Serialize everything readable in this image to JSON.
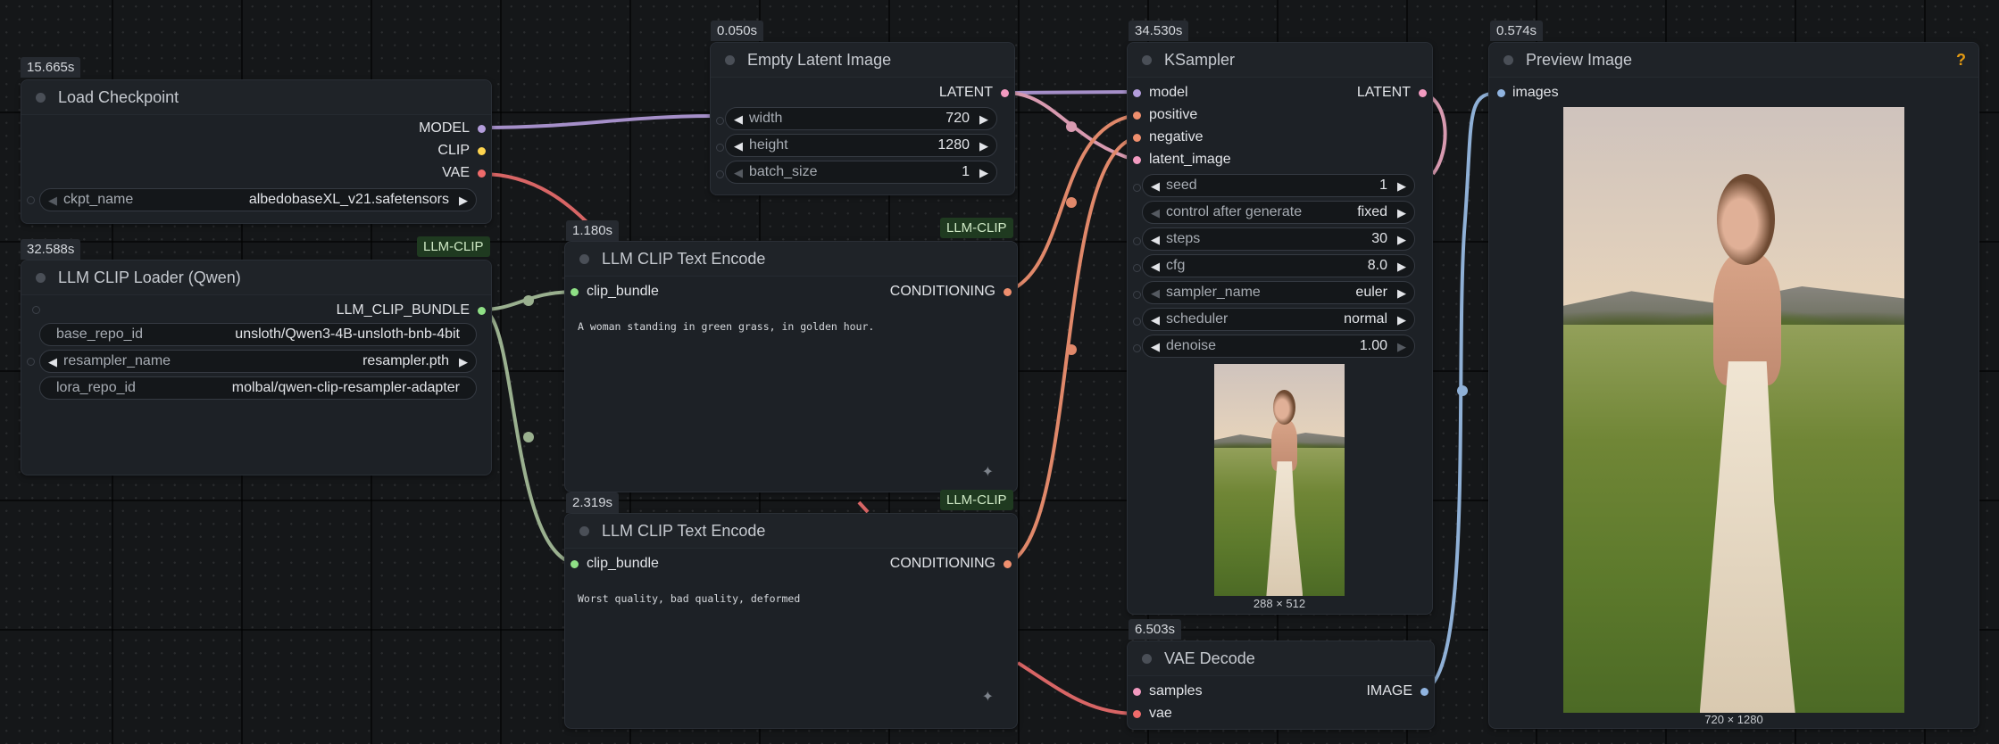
{
  "colors": {
    "model": "#b39ddb",
    "clip": "#ffd54f",
    "vae": "#ef6b6b",
    "latent": "#f29ac0",
    "conditioning": "#ef8f6e",
    "llm_clip": "#8fe086",
    "image": "#90b4e0",
    "tag_bg": "#1f3a20"
  },
  "nodes": {
    "load_checkpoint": {
      "time": "15.665s",
      "title": "Load Checkpoint",
      "outputs": [
        "MODEL",
        "CLIP",
        "VAE"
      ],
      "ckpt_label": "ckpt_name",
      "ckpt_value": "albedobaseXL_v21.safetensors"
    },
    "llm_clip_loader": {
      "time": "32.588s",
      "tag": "LLM-CLIP",
      "title": "LLM CLIP Loader (Qwen)",
      "output": "LLM_CLIP_BUNDLE",
      "widgets": [
        {
          "label": "base_repo_id",
          "value": "unsloth/Qwen3-4B-unsloth-bnb-4bit"
        },
        {
          "label": "resampler_name",
          "value": "resampler.pth"
        },
        {
          "label": "lora_repo_id",
          "value": "molbal/qwen-clip-resampler-adapter"
        }
      ]
    },
    "empty_latent": {
      "time": "0.050s",
      "title": "Empty Latent Image",
      "output": "LATENT",
      "widgets": [
        {
          "label": "width",
          "value": "720"
        },
        {
          "label": "height",
          "value": "1280"
        },
        {
          "label": "batch_size",
          "value": "1"
        }
      ]
    },
    "text_encode_pos": {
      "time": "1.180s",
      "tag": "LLM-CLIP",
      "title": "LLM CLIP Text Encode",
      "input": "clip_bundle",
      "output": "CONDITIONING",
      "prompt": "A woman standing in green grass, in golden hour."
    },
    "text_encode_neg": {
      "time": "2.319s",
      "tag": "LLM-CLIP",
      "title": "LLM CLIP Text Encode",
      "input": "clip_bundle",
      "output": "CONDITIONING",
      "prompt": "Worst quality, bad quality, deformed"
    },
    "ksampler": {
      "time": "34.530s",
      "title": "KSampler",
      "inputs": [
        "model",
        "positive",
        "negative",
        "latent_image"
      ],
      "output": "LATENT",
      "widgets": [
        {
          "label": "seed",
          "value": "1"
        },
        {
          "label": "control after generate",
          "value": "fixed"
        },
        {
          "label": "steps",
          "value": "30"
        },
        {
          "label": "cfg",
          "value": "8.0"
        },
        {
          "label": "sampler_name",
          "value": "euler"
        },
        {
          "label": "scheduler",
          "value": "normal"
        },
        {
          "label": "denoise",
          "value": "1.00"
        }
      ],
      "preview_size": "288 × 512"
    },
    "vae_decode": {
      "time": "6.503s",
      "title": "VAE Decode",
      "inputs": [
        "samples",
        "vae"
      ],
      "output": "IMAGE"
    },
    "preview_image": {
      "time": "0.574s",
      "title": "Preview Image",
      "input": "images",
      "help": "?",
      "image_size": "720 × 1280"
    }
  }
}
